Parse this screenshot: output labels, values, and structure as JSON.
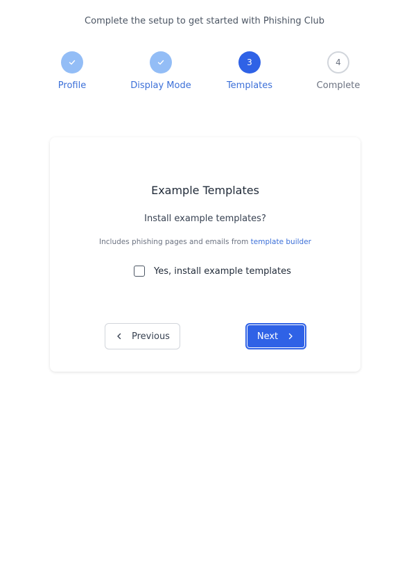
{
  "header": {
    "subtitle": "Complete the setup to get started with Phishing Club"
  },
  "stepper": {
    "steps": [
      {
        "number": "1",
        "label": "Profile",
        "status": "completed"
      },
      {
        "number": "2",
        "label": "Display Mode",
        "status": "completed"
      },
      {
        "number": "3",
        "label": "Templates",
        "status": "current"
      },
      {
        "number": "4",
        "label": "Complete",
        "status": "pending"
      }
    ],
    "colors": {
      "completed": "#93bdf6",
      "current": "#2f62e6",
      "active_label": "#3b6fd8"
    }
  },
  "card": {
    "title": "Example Templates",
    "question": "Install example templates?",
    "note_prefix": "Includes phishing pages and emails from",
    "note_link": "template builder",
    "checkbox": {
      "label": "Yes, install example templates",
      "checked": false
    },
    "buttons": {
      "previous": "Previous",
      "next": "Next"
    }
  }
}
